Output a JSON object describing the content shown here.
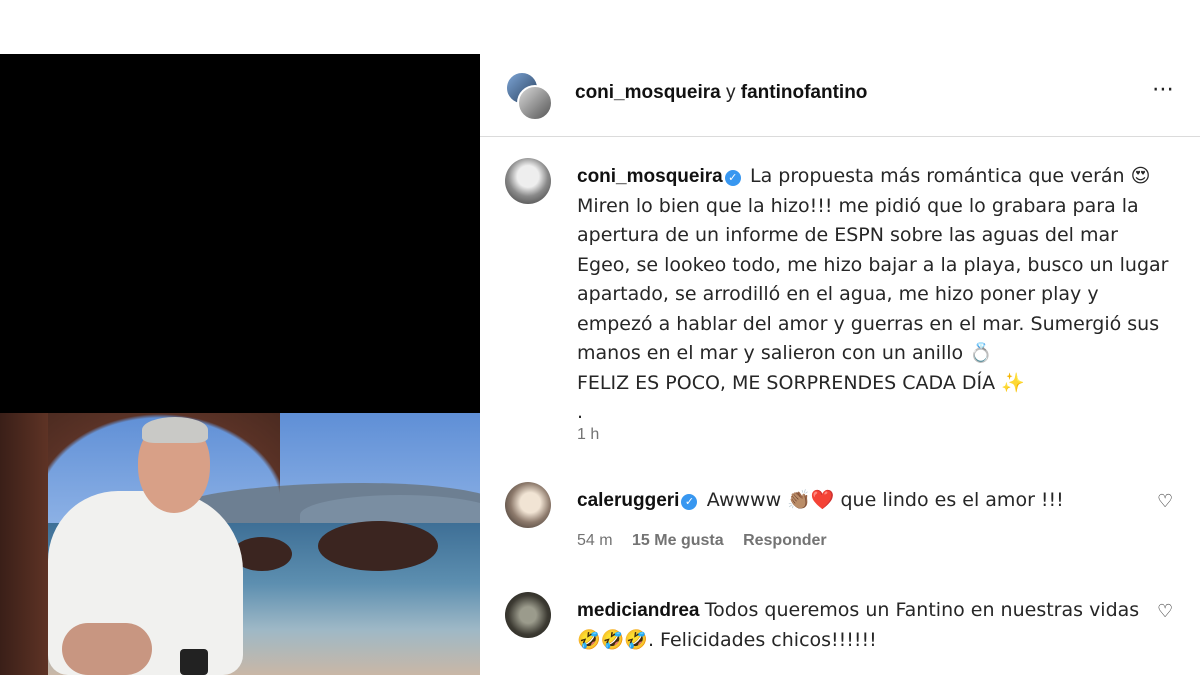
{
  "post": {
    "collaborators": {
      "user1": "coni_mosqueira",
      "joiner": "y",
      "user2": "fantinofantino"
    },
    "more_icon": "⋯",
    "caption": {
      "username": "coni_mosqueira",
      "text": "La propuesta más romántica que verán 😍\nMiren lo bien que la hizo!!! me pidió que lo grabara para la apertura de un informe de ESPN sobre las aguas del mar Egeo, se lookeo todo, me hizo bajar a la playa, busco un lugar apartado, se arrodilló en el agua, me hizo poner play y empezó a hablar del amor y guerras en el mar. Sumergió sus manos en el mar y salieron con un anillo 💍\nFELIZ ES POCO, ME SORPRENDES CADA DÍA ✨\n.",
      "time_ago": "1 h"
    },
    "comments": [
      {
        "username": "caleruggeri",
        "verified": true,
        "text": "Awwww 👏🏽❤️ que lindo es el amor !!!",
        "time": "54 m",
        "likes": "15 Me gusta",
        "reply": "Responder"
      },
      {
        "username": "mediciandrea",
        "verified": false,
        "text": "Todos queremos un Fantino en nuestras vidas🤣🤣🤣. Felicidades chicos!!!!!!"
      }
    ],
    "icons": {
      "verified": "✓",
      "like_comment": "♡"
    }
  }
}
